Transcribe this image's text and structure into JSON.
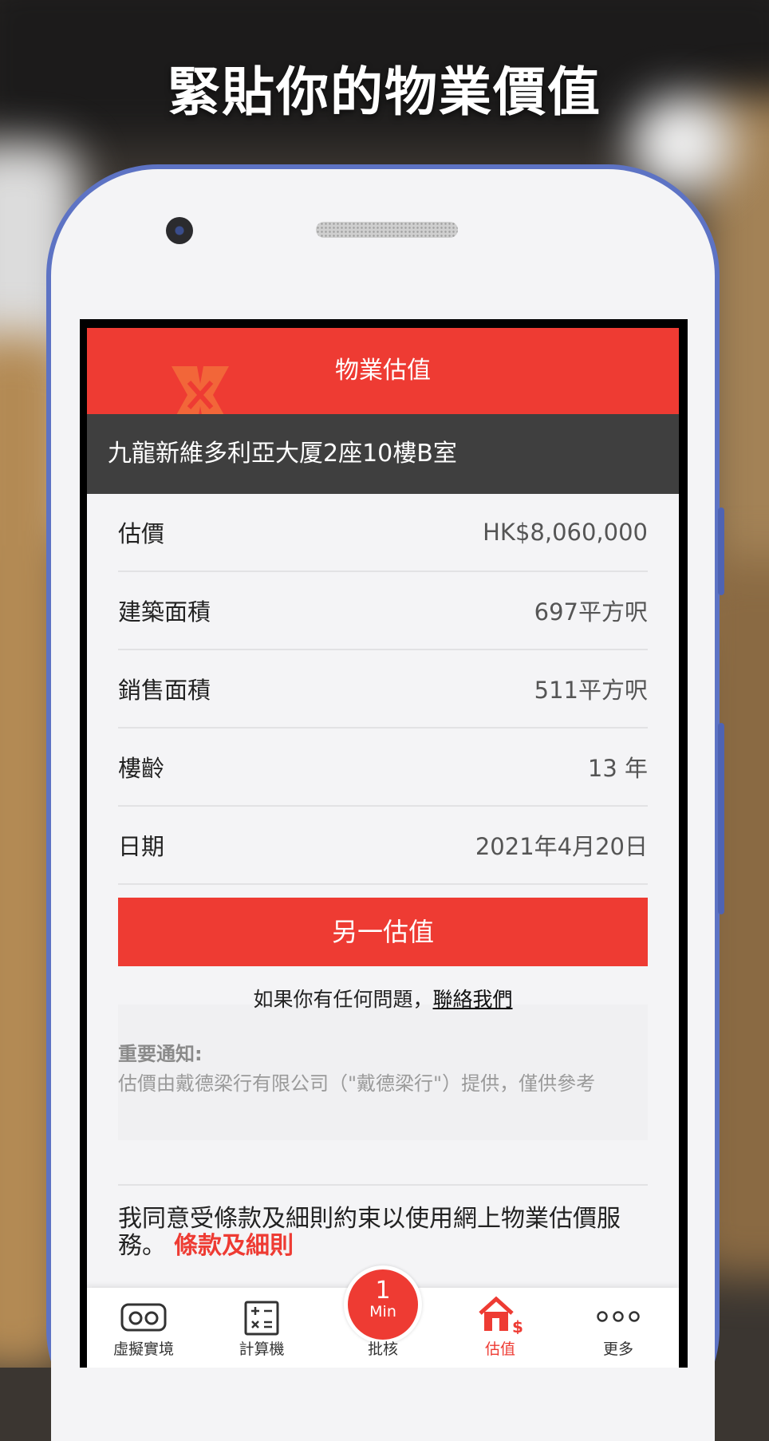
{
  "headline": "緊貼你的物業價值",
  "app": {
    "header_title": "物業估值",
    "address": "九龍新維多利亞大厦2座10樓B室",
    "details": [
      {
        "label": "估價",
        "value": "HK$8,060,000"
      },
      {
        "label": "建築面積",
        "value": "697平方呎"
      },
      {
        "label": "銷售面積",
        "value": "511平方呎"
      },
      {
        "label": "樓齡",
        "value": "13 年"
      },
      {
        "label": "日期",
        "value": "2021年4月20日"
      }
    ],
    "action_button": "另一估值",
    "contact_text": "如果你有任何問題，",
    "contact_link": "聯絡我們",
    "notice_heading": "重要通知:",
    "notice_body": "估價由戴德梁行有限公司（\"戴德梁行\"）提供，僅供參考",
    "agreement_text": "我同意受條款及細則約束以使用網上物業估價服務。",
    "agreement_link": "條款及細則"
  },
  "tabbar": {
    "items": [
      {
        "label": "虛擬實境",
        "icon": "vr-headset-icon"
      },
      {
        "label": "計算機",
        "icon": "calculator-icon"
      },
      {
        "label": "批核",
        "icon": "min-badge-icon",
        "badge_number": "1",
        "badge_unit": "Min"
      },
      {
        "label": "估值",
        "icon": "house-dollar-icon",
        "active": true
      },
      {
        "label": "更多",
        "icon": "more-dots-icon"
      }
    ]
  },
  "colors": {
    "accent": "#ee3b33",
    "address_bar": "#3f3f3f",
    "phone_frame": "#5d73c4"
  }
}
